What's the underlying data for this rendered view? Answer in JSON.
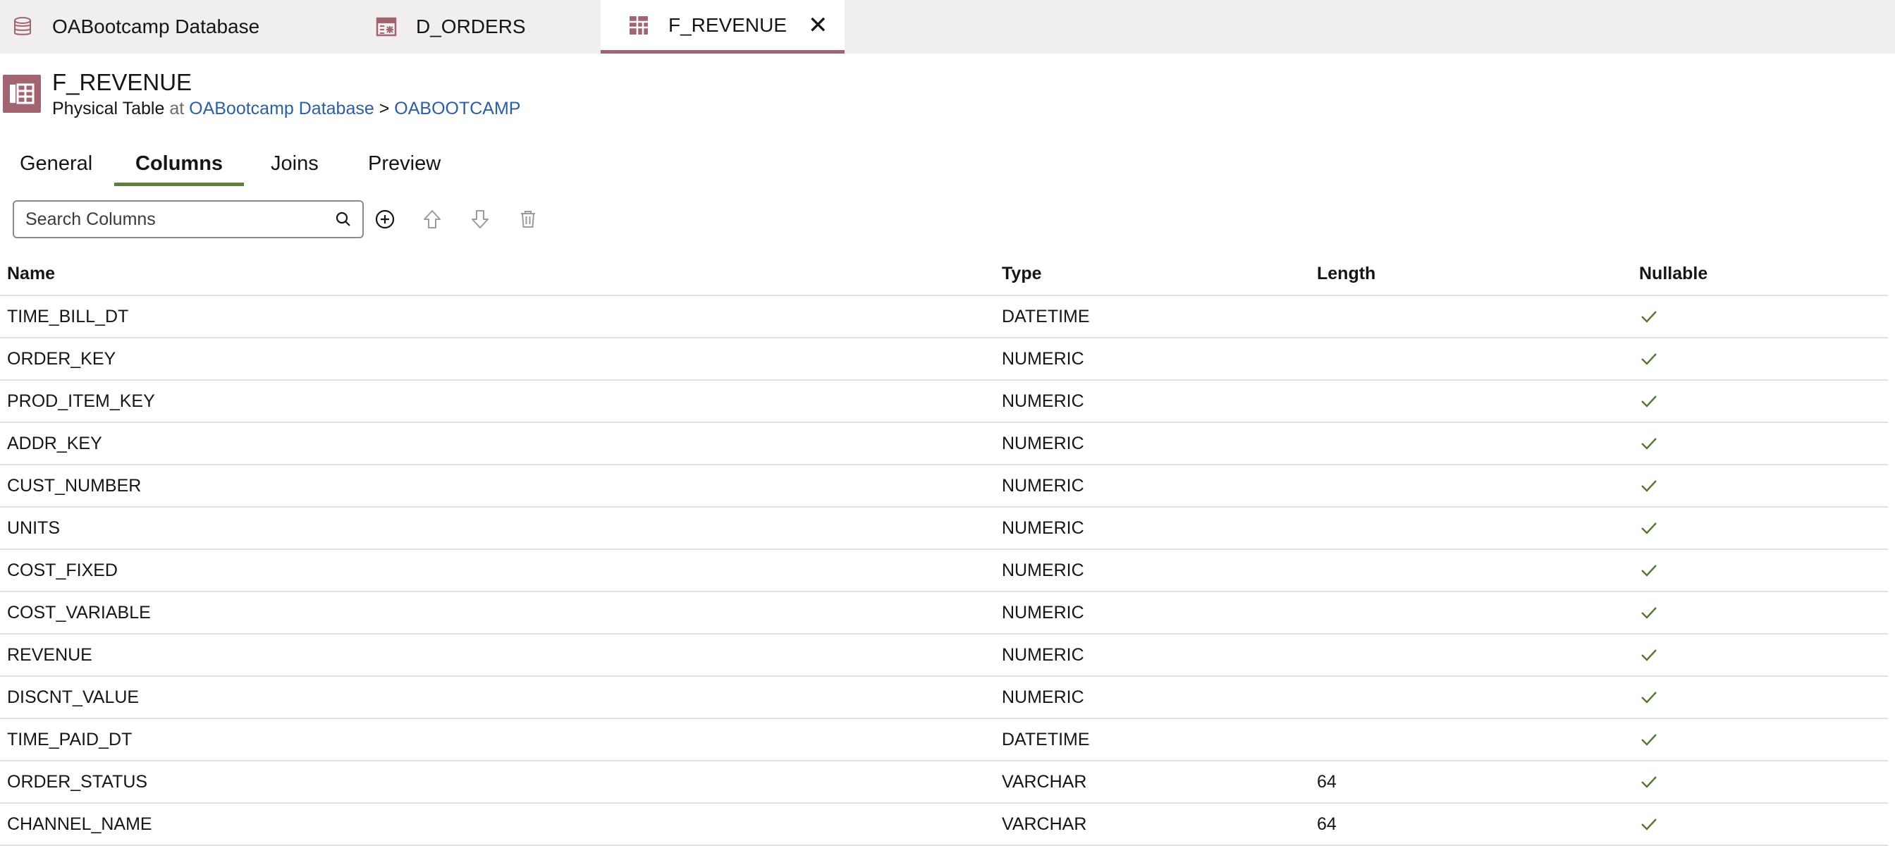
{
  "tabs": [
    {
      "label": "OABootcamp Database",
      "icon": "database-icon"
    },
    {
      "label": "D_ORDERS",
      "icon": "dimension-table-icon"
    },
    {
      "label": "F_REVENUE",
      "icon": "table-icon",
      "active": true,
      "close": "✕"
    }
  ],
  "header": {
    "title": "F_REVENUE",
    "object_type": "Physical Table",
    "at_text": "at",
    "database_link": "OABootcamp Database",
    "separator": ">",
    "schema_link": "OABOOTCAMP"
  },
  "inner_tabs": [
    "General",
    "Columns",
    "Joins",
    "Preview"
  ],
  "active_inner_tab": "Columns",
  "toolbar": {
    "search_placeholder": "Search Columns",
    "add_icon": "add-circle-icon",
    "move_up_icon": "arrow-up-icon",
    "move_down_icon": "arrow-down-icon",
    "delete_icon": "trash-icon"
  },
  "columns_table": {
    "headers": [
      "Name",
      "Type",
      "Length",
      "Nullable"
    ],
    "rows": [
      {
        "name": "TIME_BILL_DT",
        "type": "DATETIME",
        "length": "",
        "nullable": true
      },
      {
        "name": "ORDER_KEY",
        "type": "NUMERIC",
        "length": "",
        "nullable": true
      },
      {
        "name": "PROD_ITEM_KEY",
        "type": "NUMERIC",
        "length": "",
        "nullable": true
      },
      {
        "name": "ADDR_KEY",
        "type": "NUMERIC",
        "length": "",
        "nullable": true
      },
      {
        "name": "CUST_NUMBER",
        "type": "NUMERIC",
        "length": "",
        "nullable": true
      },
      {
        "name": "UNITS",
        "type": "NUMERIC",
        "length": "",
        "nullable": true
      },
      {
        "name": "COST_FIXED",
        "type": "NUMERIC",
        "length": "",
        "nullable": true
      },
      {
        "name": "COST_VARIABLE",
        "type": "NUMERIC",
        "length": "",
        "nullable": true
      },
      {
        "name": "REVENUE",
        "type": "NUMERIC",
        "length": "",
        "nullable": true
      },
      {
        "name": "DISCNT_VALUE",
        "type": "NUMERIC",
        "length": "",
        "nullable": true
      },
      {
        "name": "TIME_PAID_DT",
        "type": "DATETIME",
        "length": "",
        "nullable": true
      },
      {
        "name": "ORDER_STATUS",
        "type": "VARCHAR",
        "length": "64",
        "nullable": true
      },
      {
        "name": "CHANNEL_NAME",
        "type": "VARCHAR",
        "length": "64",
        "nullable": true
      }
    ]
  },
  "colors": {
    "accent": "#a36472",
    "active_tab_underline": "#5c7f3c",
    "link": "#2c5ea3",
    "check": "#4f7a34"
  }
}
